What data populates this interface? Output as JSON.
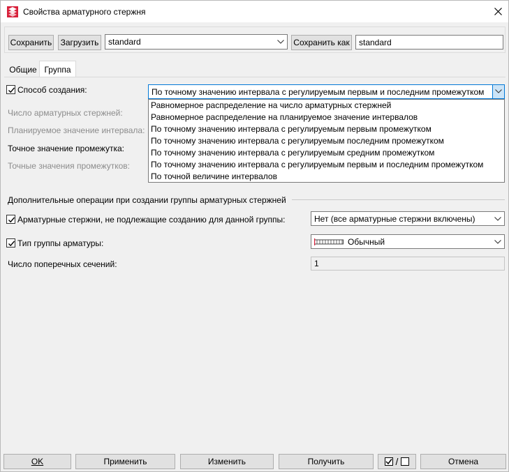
{
  "window": {
    "title": "Свойства арматурного стержня"
  },
  "toolbar": {
    "save_label": "Сохранить",
    "load_label": "Загрузить",
    "preset_value": "standard",
    "save_as_label": "Сохранить как",
    "save_as_value": "standard"
  },
  "tabs": [
    {
      "label": "Общие",
      "active": false
    },
    {
      "label": "Группа",
      "active": true
    }
  ],
  "group": {
    "creation_method": {
      "label": "Способ создания:",
      "checked": true,
      "selected": "По точному значению интервала с регулируемым первым и последним промежутком",
      "options": [
        "Равномерное распределение на число арматурных стержней",
        "Равномерное распределение на планируемое значение интервалов",
        "По точному значению интервала с регулируемым первым промежутком",
        "По точному значению интервала с регулируемым последним промежутком",
        "По точному значению интервала с регулируемым средним промежутком",
        "По точному значению интервала с регулируемым первым и последним промежутком",
        "По точной величине интервалов"
      ]
    },
    "rows": {
      "bar_count": "Число арматурных стержней:",
      "planned_interval": "Планируемое значение интервала:",
      "exact_gap": "Точное значение промежутка:",
      "exact_gaps": "Точные значения промежутков:"
    },
    "extra_ops_title": "Дополнительные операции при создании группы арматурных стержней",
    "excluded_bars": {
      "label": "Арматурные стержни, не подлежащие созданию для данной группы:",
      "checked": true,
      "value": "Нет (все арматурные стержни включены)"
    },
    "group_type": {
      "label": "Тип группы арматуры:",
      "checked": true,
      "value": "Обычный"
    },
    "cross_sections": {
      "label": "Число поперечных сечений:",
      "value": "1"
    }
  },
  "bottom": {
    "ok": "OK",
    "apply": "Применить",
    "modify": "Изменить",
    "get": "Получить",
    "toggle_sep": "/",
    "cancel": "Отмена"
  },
  "colors": {
    "dialog_bg": "#f0f0f0",
    "button_bg": "#e1e1e1",
    "icon_red": "#d8203a"
  }
}
